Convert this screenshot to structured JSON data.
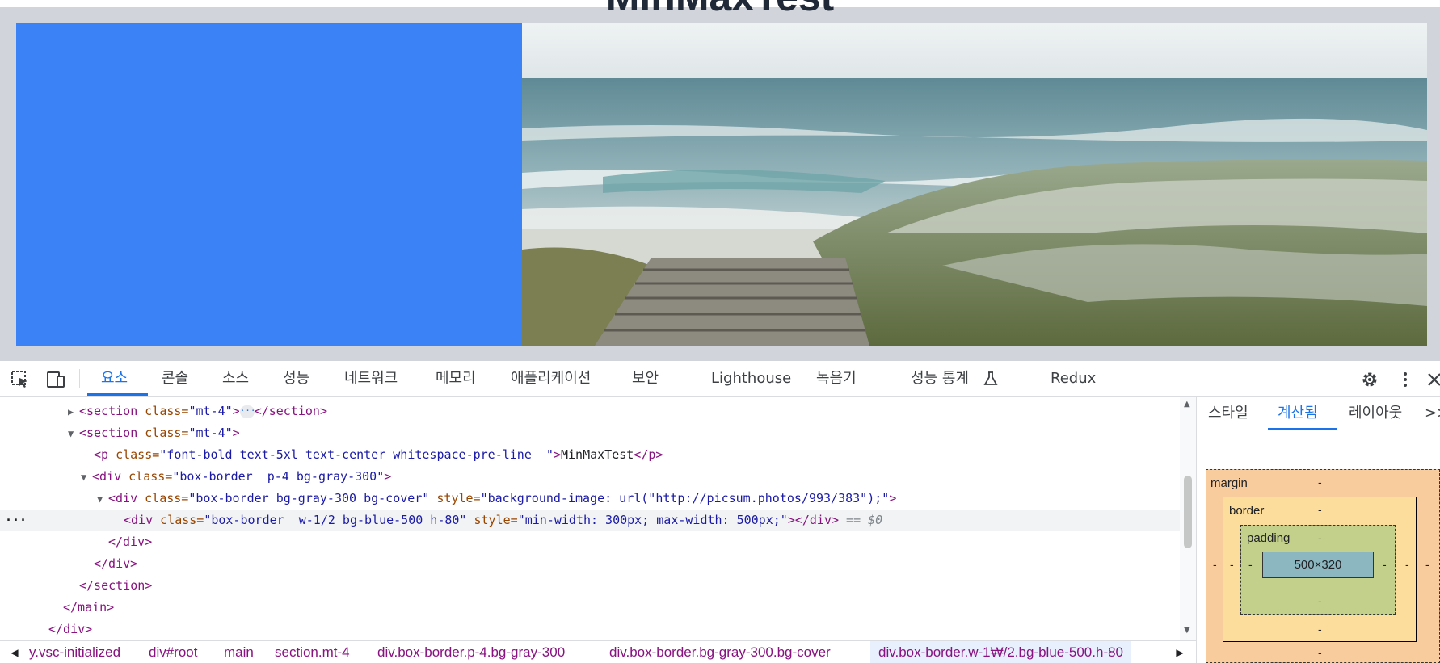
{
  "page": {
    "heading": "MinMaxTest"
  },
  "devtools": {
    "tabs": [
      "요소",
      "콘솔",
      "소스",
      "성능",
      "네트워크",
      "메모리",
      "애플리케이션",
      "보안",
      "Lighthouse",
      "녹음기",
      "성능 통계",
      "Redux"
    ],
    "active_tab": "요소",
    "icons": [
      "inspect-element-icon",
      "device-toolbar-icon",
      "experiment-flask-icon",
      "settings-gear-icon",
      "more-vert-icon",
      "close-icon"
    ]
  },
  "elements": {
    "line1": {
      "open": "<section",
      "attr": " class=",
      "val": "\"mt-4\"",
      "close": ">",
      "end": "</section>"
    },
    "line2": {
      "open": "<section",
      "attr": " class=",
      "val": "\"mt-4\"",
      "close": ">"
    },
    "line3": {
      "open": "<p",
      "attr": " class=",
      "val": "\"font-bold text-5xl text-center whitespace-pre-line  \"",
      "close": ">",
      "text": "MinMaxTest",
      "end": "</p>"
    },
    "line4": {
      "open": "<div",
      "attr": " class=",
      "val": "\"box-border  p-4 bg-gray-300\"",
      "close": ">"
    },
    "line5": {
      "open": "<div",
      "attr": " class=",
      "val": "\"box-border bg-gray-300 bg-cover\"",
      "attr2": " style=",
      "val2": "\"background-image: url(\"http://picsum.photos/993/383\");\"",
      "close": ">"
    },
    "line6": {
      "open": "<div",
      "attr": " class=",
      "val": "\"box-border  w-1/2 bg-blue-500 h-80\"",
      "attr2": " style=",
      "val2": "\"min-width: 300px; max-width: 500px;\"",
      "close": "></div>",
      "marker": " == $0"
    },
    "line7": "</div>",
    "line8": "</div>",
    "line9": "</section>",
    "line10": "</main>",
    "line11": "</div>"
  },
  "breadcrumb": [
    "y.vsc-initialized",
    "div#root",
    "main",
    "section.mt-4",
    "div.box-border.p-4.bg-gray-300",
    "div.box-border.bg-gray-300.bg-cover",
    "div.box-border.w-1₩/2.bg-blue-500.h-80"
  ],
  "sidebar": {
    "tabs": [
      "스타일",
      "계산됨",
      "레이아웃"
    ],
    "active_tab": "계산됨",
    "more": ">>",
    "box_model": {
      "margin_label": "margin",
      "border_label": "border",
      "padding_label": "padding",
      "content": "500×320",
      "dash": "-"
    }
  },
  "colors": {
    "blue_box": "#3b82f6",
    "gray_bg": "#d1d5db",
    "accent": "#1a73e8"
  }
}
